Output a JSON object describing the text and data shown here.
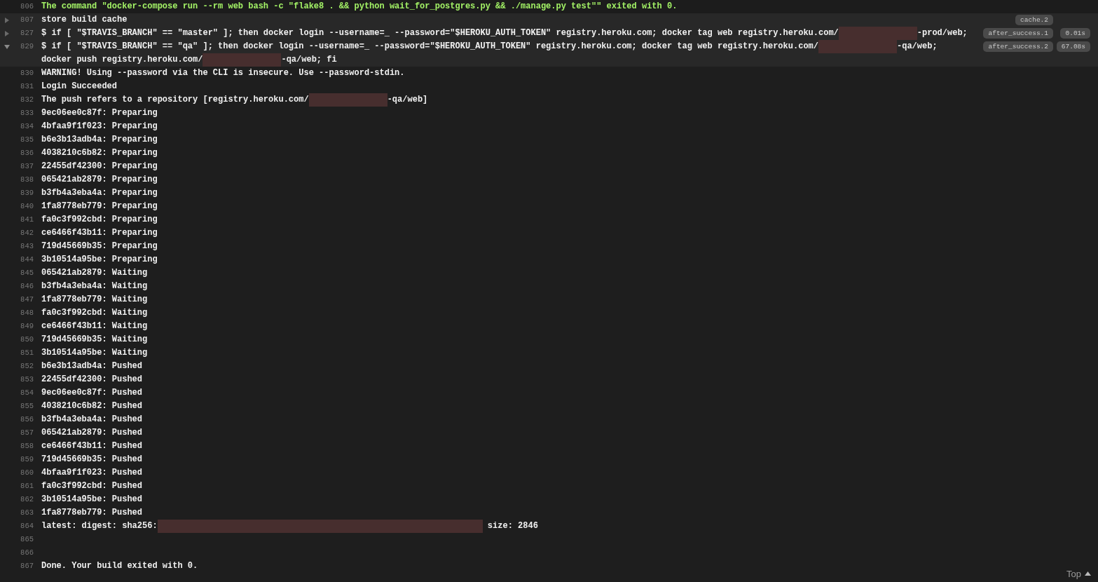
{
  "lines": [
    {
      "number": "806",
      "kind": "success",
      "segments": [
        {
          "kind": "text",
          "text": "The command \"docker-compose run --rm web bash -c \"flake8 . && python wait_for_postgres.py && ./manage.py test\"\" exited with 0."
        }
      ]
    },
    {
      "number": "807",
      "kind": "fold",
      "expanded": false,
      "segments": [
        {
          "kind": "text",
          "text": "store build cache"
        }
      ],
      "tag": "cache.2"
    },
    {
      "number": "827",
      "kind": "fold",
      "expanded": false,
      "segments": [
        {
          "kind": "text",
          "text": "$ if [ \"$TRAVIS_BRANCH\" == \"master\" ]; then docker login --username=_ --password=\"$HEROKU_AUTH_TOKEN\" registry.heroku.com; docker tag web registry.heroku.com/"
        },
        {
          "kind": "redacted"
        },
        {
          "kind": "text",
          "text": "-prod/web;"
        }
      ],
      "tag": "after_success.1",
      "time": "0.01s"
    },
    {
      "number": "829",
      "kind": "fold",
      "expanded": true,
      "segments": [
        {
          "kind": "text",
          "text": "$ if [ \"$TRAVIS_BRANCH\" == \"qa\" ]; then docker login --username=_ --password=\"$HEROKU_AUTH_TOKEN\" registry.heroku.com; docker tag web registry.heroku.com/"
        },
        {
          "kind": "redacted"
        },
        {
          "kind": "text",
          "text": "-qa/web; "
        },
        {
          "kind": "text",
          "text": "docker push registry.heroku.com/"
        },
        {
          "kind": "redacted"
        },
        {
          "kind": "text",
          "text": "-qa/web; fi"
        }
      ],
      "tag": "after_success.2",
      "time": "67.08s"
    },
    {
      "number": "830",
      "kind": "plain",
      "segments": [
        {
          "kind": "text",
          "text": "WARNING! Using --password via the CLI is insecure. Use --password-stdin."
        }
      ]
    },
    {
      "number": "831",
      "kind": "plain",
      "segments": [
        {
          "kind": "text",
          "text": "Login Succeeded"
        }
      ]
    },
    {
      "number": "832",
      "kind": "plain",
      "segments": [
        {
          "kind": "text",
          "text": "The push refers to a repository [registry.heroku.com/"
        },
        {
          "kind": "redacted"
        },
        {
          "kind": "text",
          "text": "-qa/web]"
        }
      ]
    },
    {
      "number": "833",
      "kind": "plain",
      "segments": [
        {
          "kind": "text",
          "text": "9ec06ee0c87f: Preparing"
        }
      ]
    },
    {
      "number": "834",
      "kind": "plain",
      "segments": [
        {
          "kind": "text",
          "text": "4bfaa9f1f023: Preparing"
        }
      ]
    },
    {
      "number": "835",
      "kind": "plain",
      "segments": [
        {
          "kind": "text",
          "text": "b6e3b13adb4a: Preparing"
        }
      ]
    },
    {
      "number": "836",
      "kind": "plain",
      "segments": [
        {
          "kind": "text",
          "text": "4038210c6b82: Preparing"
        }
      ]
    },
    {
      "number": "837",
      "kind": "plain",
      "segments": [
        {
          "kind": "text",
          "text": "22455df42300: Preparing"
        }
      ]
    },
    {
      "number": "838",
      "kind": "plain",
      "segments": [
        {
          "kind": "text",
          "text": "065421ab2879: Preparing"
        }
      ]
    },
    {
      "number": "839",
      "kind": "plain",
      "segments": [
        {
          "kind": "text",
          "text": "b3fb4a3eba4a: Preparing"
        }
      ]
    },
    {
      "number": "840",
      "kind": "plain",
      "segments": [
        {
          "kind": "text",
          "text": "1fa8778eb779: Preparing"
        }
      ]
    },
    {
      "number": "841",
      "kind": "plain",
      "segments": [
        {
          "kind": "text",
          "text": "fa0c3f992cbd: Preparing"
        }
      ]
    },
    {
      "number": "842",
      "kind": "plain",
      "segments": [
        {
          "kind": "text",
          "text": "ce6466f43b11: Preparing"
        }
      ]
    },
    {
      "number": "843",
      "kind": "plain",
      "segments": [
        {
          "kind": "text",
          "text": "719d45669b35: Preparing"
        }
      ]
    },
    {
      "number": "844",
      "kind": "plain",
      "segments": [
        {
          "kind": "text",
          "text": "3b10514a95be: Preparing"
        }
      ]
    },
    {
      "number": "845",
      "kind": "plain",
      "segments": [
        {
          "kind": "text",
          "text": "065421ab2879: Waiting"
        }
      ]
    },
    {
      "number": "846",
      "kind": "plain",
      "segments": [
        {
          "kind": "text",
          "text": "b3fb4a3eba4a: Waiting"
        }
      ]
    },
    {
      "number": "847",
      "kind": "plain",
      "segments": [
        {
          "kind": "text",
          "text": "1fa8778eb779: Waiting"
        }
      ]
    },
    {
      "number": "848",
      "kind": "plain",
      "segments": [
        {
          "kind": "text",
          "text": "fa0c3f992cbd: Waiting"
        }
      ]
    },
    {
      "number": "849",
      "kind": "plain",
      "segments": [
        {
          "kind": "text",
          "text": "ce6466f43b11: Waiting"
        }
      ]
    },
    {
      "number": "850",
      "kind": "plain",
      "segments": [
        {
          "kind": "text",
          "text": "719d45669b35: Waiting"
        }
      ]
    },
    {
      "number": "851",
      "kind": "plain",
      "segments": [
        {
          "kind": "text",
          "text": "3b10514a95be: Waiting"
        }
      ]
    },
    {
      "number": "852",
      "kind": "plain",
      "segments": [
        {
          "kind": "text",
          "text": "b6e3b13adb4a: Pushed"
        }
      ]
    },
    {
      "number": "853",
      "kind": "plain",
      "segments": [
        {
          "kind": "text",
          "text": "22455df42300: Pushed"
        }
      ]
    },
    {
      "number": "854",
      "kind": "plain",
      "segments": [
        {
          "kind": "text",
          "text": "9ec06ee0c87f: Pushed"
        }
      ]
    },
    {
      "number": "855",
      "kind": "plain",
      "segments": [
        {
          "kind": "text",
          "text": "4038210c6b82: Pushed"
        }
      ]
    },
    {
      "number": "856",
      "kind": "plain",
      "segments": [
        {
          "kind": "text",
          "text": "b3fb4a3eba4a: Pushed"
        }
      ]
    },
    {
      "number": "857",
      "kind": "plain",
      "segments": [
        {
          "kind": "text",
          "text": "065421ab2879: Pushed"
        }
      ]
    },
    {
      "number": "858",
      "kind": "plain",
      "segments": [
        {
          "kind": "text",
          "text": "ce6466f43b11: Pushed"
        }
      ]
    },
    {
      "number": "859",
      "kind": "plain",
      "segments": [
        {
          "kind": "text",
          "text": "719d45669b35: Pushed"
        }
      ]
    },
    {
      "number": "860",
      "kind": "plain",
      "segments": [
        {
          "kind": "text",
          "text": "4bfaa9f1f023: Pushed"
        }
      ]
    },
    {
      "number": "861",
      "kind": "plain",
      "segments": [
        {
          "kind": "text",
          "text": "fa0c3f992cbd: Pushed"
        }
      ]
    },
    {
      "number": "862",
      "kind": "plain",
      "segments": [
        {
          "kind": "text",
          "text": "3b10514a95be: Pushed"
        }
      ]
    },
    {
      "number": "863",
      "kind": "plain",
      "segments": [
        {
          "kind": "text",
          "text": "1fa8778eb779: Pushed"
        }
      ]
    },
    {
      "number": "864",
      "kind": "plain",
      "segments": [
        {
          "kind": "text",
          "text": "latest: digest: sha256:"
        },
        {
          "kind": "redacted_long"
        },
        {
          "kind": "text",
          "text": " size: 2846"
        }
      ]
    },
    {
      "number": "865",
      "kind": "plain"
    },
    {
      "number": "866",
      "kind": "plain"
    },
    {
      "number": "867",
      "kind": "plain",
      "segments": [
        {
          "kind": "text",
          "text": "Done. Your build exited with 0."
        }
      ]
    }
  ],
  "top_link": {
    "label": "Top"
  }
}
